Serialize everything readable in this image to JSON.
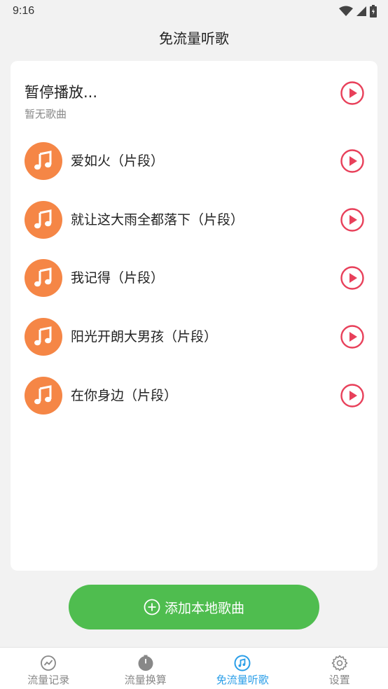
{
  "status_bar": {
    "time": "9:16"
  },
  "header": {
    "title": "免流量听歌"
  },
  "now_playing": {
    "title": "暂停播放...",
    "subtitle": "暂无歌曲"
  },
  "songs": [
    {
      "name": "爱如火（片段）"
    },
    {
      "name": "就让这大雨全都落下（片段）"
    },
    {
      "name": "我记得（片段）"
    },
    {
      "name": "阳光开朗大男孩（片段）"
    },
    {
      "name": "在你身边（片段）"
    }
  ],
  "add_button": {
    "label": "添加本地歌曲"
  },
  "tabs": [
    {
      "label": "流量记录",
      "icon": "chart-icon",
      "active": false
    },
    {
      "label": "流量换算",
      "icon": "timer-icon",
      "active": false
    },
    {
      "label": "免流量听歌",
      "icon": "music-icon",
      "active": true
    },
    {
      "label": "设置",
      "icon": "gear-icon",
      "active": false
    }
  ],
  "colors": {
    "accent_green": "#4fbd4f",
    "cover_orange": "#f58646",
    "play_red": "#e8405a",
    "tab_active": "#2a9ee8"
  }
}
